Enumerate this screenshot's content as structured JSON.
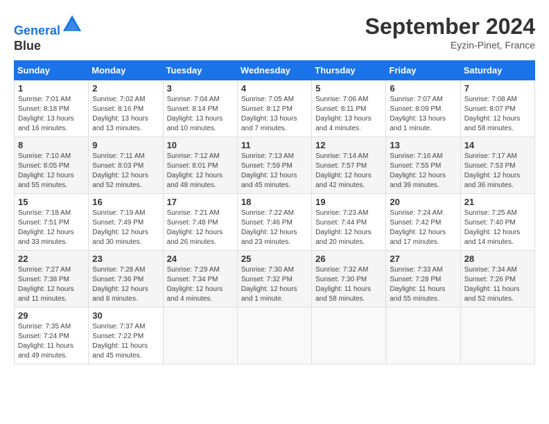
{
  "header": {
    "logo_line1": "General",
    "logo_line2": "Blue",
    "month_title": "September 2024",
    "location": "Eyzin-Pinet, France"
  },
  "calendar": {
    "days_of_week": [
      "Sunday",
      "Monday",
      "Tuesday",
      "Wednesday",
      "Thursday",
      "Friday",
      "Saturday"
    ],
    "weeks": [
      [
        {
          "day": "",
          "detail": ""
        },
        {
          "day": "2",
          "detail": "Sunrise: 7:02 AM\nSunset: 8:16 PM\nDaylight: 13 hours\nand 13 minutes."
        },
        {
          "day": "3",
          "detail": "Sunrise: 7:04 AM\nSunset: 8:14 PM\nDaylight: 13 hours\nand 10 minutes."
        },
        {
          "day": "4",
          "detail": "Sunrise: 7:05 AM\nSunset: 8:12 PM\nDaylight: 13 hours\nand 7 minutes."
        },
        {
          "day": "5",
          "detail": "Sunrise: 7:06 AM\nSunset: 8:11 PM\nDaylight: 13 hours\nand 4 minutes."
        },
        {
          "day": "6",
          "detail": "Sunrise: 7:07 AM\nSunset: 8:09 PM\nDaylight: 13 hours\nand 1 minute."
        },
        {
          "day": "7",
          "detail": "Sunrise: 7:08 AM\nSunset: 8:07 PM\nDaylight: 12 hours\nand 58 minutes."
        }
      ],
      [
        {
          "day": "1",
          "detail": "Sunrise: 7:01 AM\nSunset: 8:18 PM\nDaylight: 13 hours\nand 16 minutes."
        },
        {
          "day": "8",
          "detail": "Sunrise: 7:10 AM\nSunset: 8:05 PM\nDaylight: 12 hours\nand 55 minutes."
        },
        {
          "day": "9",
          "detail": "Sunrise: 7:11 AM\nSunset: 8:03 PM\nDaylight: 12 hours\nand 52 minutes."
        },
        {
          "day": "10",
          "detail": "Sunrise: 7:12 AM\nSunset: 8:01 PM\nDaylight: 12 hours\nand 48 minutes."
        },
        {
          "day": "11",
          "detail": "Sunrise: 7:13 AM\nSunset: 7:59 PM\nDaylight: 12 hours\nand 45 minutes."
        },
        {
          "day": "12",
          "detail": "Sunrise: 7:14 AM\nSunset: 7:57 PM\nDaylight: 12 hours\nand 42 minutes."
        },
        {
          "day": "13",
          "detail": "Sunrise: 7:16 AM\nSunset: 7:55 PM\nDaylight: 12 hours\nand 39 minutes."
        },
        {
          "day": "14",
          "detail": "Sunrise: 7:17 AM\nSunset: 7:53 PM\nDaylight: 12 hours\nand 36 minutes."
        }
      ],
      [
        {
          "day": "15",
          "detail": "Sunrise: 7:18 AM\nSunset: 7:51 PM\nDaylight: 12 hours\nand 33 minutes."
        },
        {
          "day": "16",
          "detail": "Sunrise: 7:19 AM\nSunset: 7:49 PM\nDaylight: 12 hours\nand 30 minutes."
        },
        {
          "day": "17",
          "detail": "Sunrise: 7:21 AM\nSunset: 7:48 PM\nDaylight: 12 hours\nand 26 minutes."
        },
        {
          "day": "18",
          "detail": "Sunrise: 7:22 AM\nSunset: 7:46 PM\nDaylight: 12 hours\nand 23 minutes."
        },
        {
          "day": "19",
          "detail": "Sunrise: 7:23 AM\nSunset: 7:44 PM\nDaylight: 12 hours\nand 20 minutes."
        },
        {
          "day": "20",
          "detail": "Sunrise: 7:24 AM\nSunset: 7:42 PM\nDaylight: 12 hours\nand 17 minutes."
        },
        {
          "day": "21",
          "detail": "Sunrise: 7:25 AM\nSunset: 7:40 PM\nDaylight: 12 hours\nand 14 minutes."
        }
      ],
      [
        {
          "day": "22",
          "detail": "Sunrise: 7:27 AM\nSunset: 7:38 PM\nDaylight: 12 hours\nand 11 minutes."
        },
        {
          "day": "23",
          "detail": "Sunrise: 7:28 AM\nSunset: 7:36 PM\nDaylight: 12 hours\nand 8 minutes."
        },
        {
          "day": "24",
          "detail": "Sunrise: 7:29 AM\nSunset: 7:34 PM\nDaylight: 12 hours\nand 4 minutes."
        },
        {
          "day": "25",
          "detail": "Sunrise: 7:30 AM\nSunset: 7:32 PM\nDaylight: 12 hours\nand 1 minute."
        },
        {
          "day": "26",
          "detail": "Sunrise: 7:32 AM\nSunset: 7:30 PM\nDaylight: 11 hours\nand 58 minutes."
        },
        {
          "day": "27",
          "detail": "Sunrise: 7:33 AM\nSunset: 7:28 PM\nDaylight: 11 hours\nand 55 minutes."
        },
        {
          "day": "28",
          "detail": "Sunrise: 7:34 AM\nSunset: 7:26 PM\nDaylight: 11 hours\nand 52 minutes."
        }
      ],
      [
        {
          "day": "29",
          "detail": "Sunrise: 7:35 AM\nSunset: 7:24 PM\nDaylight: 11 hours\nand 49 minutes."
        },
        {
          "day": "30",
          "detail": "Sunrise: 7:37 AM\nSunset: 7:22 PM\nDaylight: 11 hours\nand 45 minutes."
        },
        {
          "day": "",
          "detail": ""
        },
        {
          "day": "",
          "detail": ""
        },
        {
          "day": "",
          "detail": ""
        },
        {
          "day": "",
          "detail": ""
        },
        {
          "day": "",
          "detail": ""
        }
      ]
    ]
  }
}
